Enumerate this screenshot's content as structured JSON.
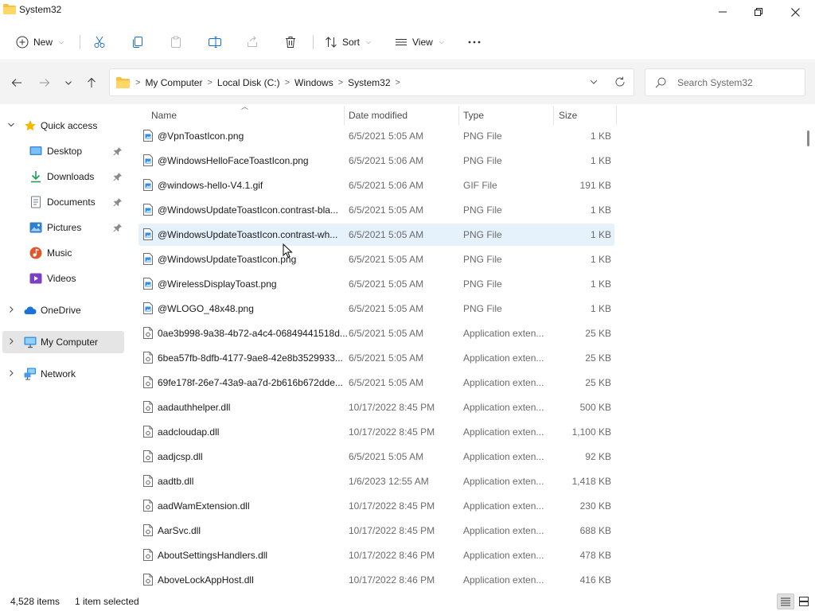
{
  "window": {
    "title": "System32"
  },
  "toolbar": {
    "new_label": "New",
    "sort_label": "Sort",
    "view_label": "View",
    "icons": [
      "cut-icon",
      "copy-icon",
      "paste-icon",
      "rename-icon",
      "share-icon",
      "delete-icon",
      "more-icon"
    ]
  },
  "address": {
    "crumbs": [
      "My Computer",
      "Local Disk (C:)",
      "Windows",
      "System32"
    ]
  },
  "search": {
    "placeholder": "Search System32"
  },
  "nav": {
    "quick_access": "Quick access",
    "desktop": "Desktop",
    "downloads": "Downloads",
    "documents": "Documents",
    "pictures": "Pictures",
    "music": "Music",
    "videos": "Videos",
    "onedrive": "OneDrive",
    "my_computer": "My Computer",
    "network": "Network"
  },
  "columns": {
    "name": "Name",
    "date": "Date modified",
    "type": "Type",
    "size": "Size"
  },
  "files": [
    {
      "name": "@VpnToastIcon.png",
      "date": "6/5/2021 5:05 AM",
      "type": "PNG File",
      "size": "1 KB",
      "kind": "image"
    },
    {
      "name": "@WindowsHelloFaceToastIcon.png",
      "date": "6/5/2021 5:06 AM",
      "type": "PNG File",
      "size": "1 KB",
      "kind": "image"
    },
    {
      "name": "@windows-hello-V4.1.gif",
      "date": "6/5/2021 5:06 AM",
      "type": "GIF File",
      "size": "191 KB",
      "kind": "image"
    },
    {
      "name": "@WindowsUpdateToastIcon.contrast-bla...",
      "date": "6/5/2021 5:05 AM",
      "type": "PNG File",
      "size": "1 KB",
      "kind": "image"
    },
    {
      "name": "@WindowsUpdateToastIcon.contrast-wh...",
      "date": "6/5/2021 5:05 AM",
      "type": "PNG File",
      "size": "1 KB",
      "kind": "image",
      "selected": true
    },
    {
      "name": "@WindowsUpdateToastIcon.png",
      "date": "6/5/2021 5:05 AM",
      "type": "PNG File",
      "size": "1 KB",
      "kind": "image"
    },
    {
      "name": "@WirelessDisplayToast.png",
      "date": "6/5/2021 5:05 AM",
      "type": "PNG File",
      "size": "1 KB",
      "kind": "image"
    },
    {
      "name": "@WLOGO_48x48.png",
      "date": "6/5/2021 5:05 AM",
      "type": "PNG File",
      "size": "1 KB",
      "kind": "image"
    },
    {
      "name": "0ae3b998-9a38-4b72-a4c4-06849441518d...",
      "date": "6/5/2021 5:05 AM",
      "type": "Application exten...",
      "size": "25 KB",
      "kind": "dll"
    },
    {
      "name": "6bea57fb-8dfb-4177-9ae8-42e8b3529933...",
      "date": "6/5/2021 5:05 AM",
      "type": "Application exten...",
      "size": "25 KB",
      "kind": "dll"
    },
    {
      "name": "69fe178f-26e7-43a9-aa7d-2b616b672dde...",
      "date": "6/5/2021 5:05 AM",
      "type": "Application exten...",
      "size": "25 KB",
      "kind": "dll"
    },
    {
      "name": "aadauthhelper.dll",
      "date": "10/17/2022 8:45 PM",
      "type": "Application exten...",
      "size": "500 KB",
      "kind": "dll"
    },
    {
      "name": "aadcloudap.dll",
      "date": "10/17/2022 8:45 PM",
      "type": "Application exten...",
      "size": "1,100 KB",
      "kind": "dll"
    },
    {
      "name": "aadjcsp.dll",
      "date": "6/5/2021 5:05 AM",
      "type": "Application exten...",
      "size": "92 KB",
      "kind": "dll"
    },
    {
      "name": "aadtb.dll",
      "date": "1/6/2023 12:55 AM",
      "type": "Application exten...",
      "size": "1,418 KB",
      "kind": "dll"
    },
    {
      "name": "aadWamExtension.dll",
      "date": "10/17/2022 8:45 PM",
      "type": "Application exten...",
      "size": "230 KB",
      "kind": "dll"
    },
    {
      "name": "AarSvc.dll",
      "date": "10/17/2022 8:45 PM",
      "type": "Application exten...",
      "size": "688 KB",
      "kind": "dll"
    },
    {
      "name": "AboutSettingsHandlers.dll",
      "date": "10/17/2022 8:46 PM",
      "type": "Application exten...",
      "size": "478 KB",
      "kind": "dll"
    },
    {
      "name": "AboveLockAppHost.dll",
      "date": "10/17/2022 8:46 PM",
      "type": "Application exten...",
      "size": "416 KB",
      "kind": "dll"
    }
  ],
  "status": {
    "items": "4,528 items",
    "selected": "1 item selected"
  },
  "colors": {
    "accent": "#0067c0",
    "selection": "#e5f1fb",
    "folder": "#f5c242"
  }
}
